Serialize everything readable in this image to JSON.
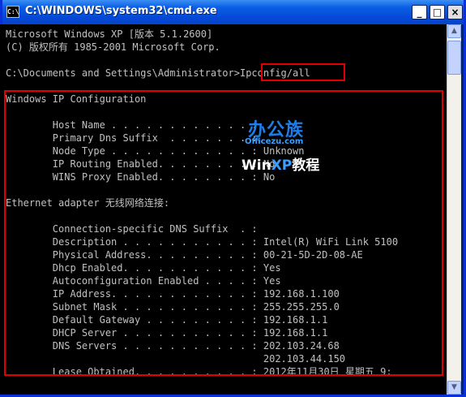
{
  "window": {
    "title": "C:\\WINDOWS\\system32\\cmd.exe",
    "icon_label": "C:\\"
  },
  "titlebar_buttons": {
    "minimize": "_",
    "maximize": "□",
    "close": "×"
  },
  "scrollbar": {
    "up": "▲",
    "down": "▼"
  },
  "console_lines": [
    "Microsoft Windows XP [版本 5.1.2600]",
    "(C) 版权所有 1985-2001 Microsoft Corp.",
    "",
    "C:\\Documents and Settings\\Administrator>Ipconfig/all",
    "",
    "Windows IP Configuration",
    "",
    "        Host Name . . . . . . . . . . . . :",
    "        Primary Dns Suffix  . . . . . . . :",
    "        Node Type . . . . . . . . . . . . : Unknown",
    "        IP Routing Enabled. . . . . . . . : No",
    "        WINS Proxy Enabled. . . . . . . . : No",
    "",
    "Ethernet adapter 无线网络连接:",
    "",
    "        Connection-specific DNS Suffix  . :",
    "        Description . . . . . . . . . . . : Intel(R) WiFi Link 5100",
    "        Physical Address. . . . . . . . . : 00-21-5D-2D-08-AE",
    "        Dhcp Enabled. . . . . . . . . . . : Yes",
    "        Autoconfiguration Enabled . . . . : Yes",
    "        IP Address. . . . . . . . . . . . : 192.168.1.100",
    "        Subnet Mask . . . . . . . . . . . : 255.255.255.0",
    "        Default Gateway . . . . . . . . . : 192.168.1.1",
    "        DHCP Server . . . . . . . . . . . : 192.168.1.1",
    "        DNS Servers . . . . . . . . . . . : 202.103.24.68",
    "                                            202.103.44.150",
    "        Lease Obtained. . . . . . . . . . : 2012年11月30日 星期五 9:"
  ],
  "watermark": {
    "main": "办公族",
    "site": "Officezu.com",
    "sub_prefix": "Win",
    "sub_xp": "XP",
    "sub_suffix": "教程"
  },
  "colors": {
    "console_bg": "#000000",
    "console_text": "#c0c0c0",
    "titlebar": "#0a5fe5",
    "highlight": "#e00000"
  }
}
